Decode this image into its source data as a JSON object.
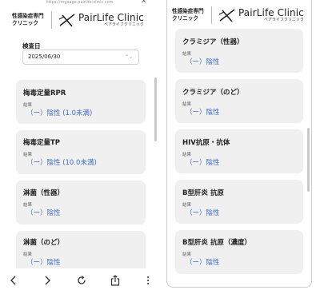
{
  "url": "https://mypage.pairlife-clinic.com",
  "header": {
    "brand_line1": "性感染症専門",
    "brand_line2": "クリニック",
    "logo_en": "PairLife Clinic",
    "logo_kana": "ペアライフクリニック"
  },
  "left": {
    "date_label": "検査日",
    "date_value": "2025/06/30",
    "result_label": "結果",
    "cards": [
      {
        "title": "梅毒定量RPR",
        "result": "（ー）陰性 (1.0未満)"
      },
      {
        "title": "梅毒定量TP",
        "result": "（ー）陰性 (10.0未満)"
      },
      {
        "title": "淋菌（性器）",
        "result": "（ー）陰性"
      },
      {
        "title": "淋菌（のど）",
        "result": "（ー）陰性"
      }
    ]
  },
  "right": {
    "result_label": "結果",
    "cards": [
      {
        "title": "クラミジア（性器）",
        "result": "（ー）陰性"
      },
      {
        "title": "クラミジア（のど）",
        "result": "（ー）陰性"
      },
      {
        "title": "HIV抗原・抗体",
        "result": "（ー）陰性"
      },
      {
        "title": "B型肝炎 抗原",
        "result": "（ー）陰性"
      },
      {
        "title": "B型肝炎 抗原（濃度）",
        "result": "（ー）陰性"
      }
    ]
  },
  "colors": {
    "result_blue": "#3f6fc8",
    "card_bg": "#f0f0f0"
  },
  "nav_icons": [
    "back-icon",
    "forward-icon",
    "reload-icon",
    "share-icon",
    "more-icon"
  ]
}
